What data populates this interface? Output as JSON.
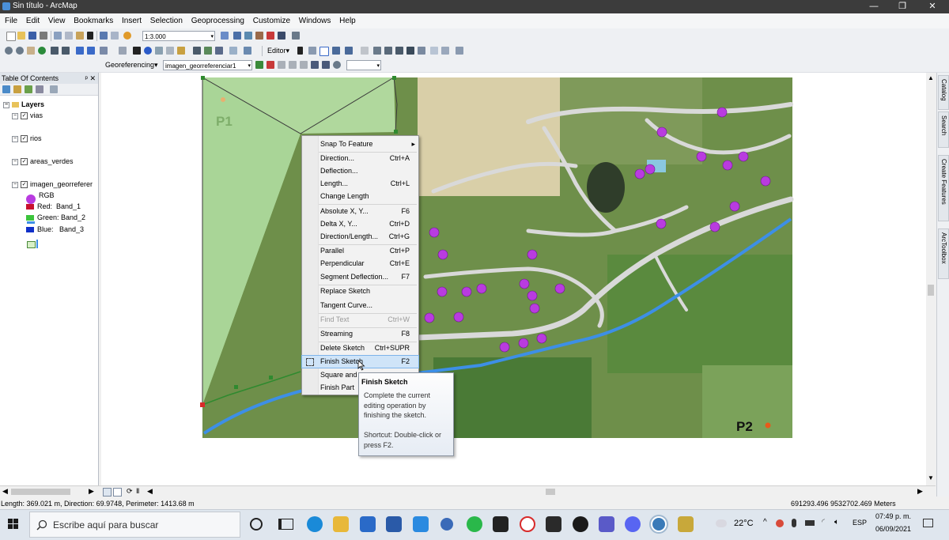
{
  "window": {
    "title": "Sin título - ArcMap",
    "minimize": "—",
    "maximize": "❐",
    "close": "✕"
  },
  "menu": [
    "File",
    "Edit",
    "View",
    "Bookmarks",
    "Insert",
    "Selection",
    "Geoprocessing",
    "Customize",
    "Windows",
    "Help"
  ],
  "toolbar": {
    "scale_value": "1:3.000",
    "editor_label": "Editor▾",
    "georef_label": "Georeferencing▾",
    "georef_layer": "imagen_georreferenciar1"
  },
  "toc": {
    "title": "Table Of Contents",
    "pin": "ᵖ ✕",
    "layers_label": "Layers",
    "layers": [
      {
        "name": "vias",
        "checked": true
      },
      {
        "name": "rios",
        "checked": true
      },
      {
        "name": "areas_verdes",
        "checked": true
      },
      {
        "name": "imagen_georreferer",
        "checked": true
      }
    ],
    "rgb_label": "RGB",
    "bands": [
      {
        "label": "Red:",
        "band": "Band_1",
        "color": "#c8102e"
      },
      {
        "label": "Green:",
        "band": "Band_2",
        "color": "#3cc43c"
      },
      {
        "label": "Blue:",
        "band": "Band_3",
        "color": "#1030c8"
      }
    ]
  },
  "map": {
    "label_p1": "P1",
    "label_p2": "P2",
    "road_color": "#d9d9d9",
    "river_color": "#3d8fe6",
    "point_color": "#b93be0",
    "green_area_color": "#b7e0a6"
  },
  "context_menu": {
    "items": [
      {
        "label": "Snap To Feature",
        "shortcut": "▸",
        "state": "normal"
      },
      {
        "label": "Direction...",
        "shortcut": "Ctrl+A",
        "state": "normal"
      },
      {
        "label": "Deflection...",
        "shortcut": "",
        "state": "normal"
      },
      {
        "label": "Length...",
        "shortcut": "Ctrl+L",
        "state": "normal"
      },
      {
        "label": "Change Length",
        "shortcut": "",
        "state": "normal"
      },
      {
        "label": "Absolute X, Y...",
        "shortcut": "F6",
        "state": "normal"
      },
      {
        "label": "Delta X, Y...",
        "shortcut": "Ctrl+D",
        "state": "normal"
      },
      {
        "label": "Direction/Length...",
        "shortcut": "Ctrl+G",
        "state": "normal"
      },
      {
        "label": "Parallel",
        "shortcut": "Ctrl+P",
        "state": "normal"
      },
      {
        "label": "Perpendicular",
        "shortcut": "Ctrl+E",
        "state": "normal"
      },
      {
        "label": "Segment Deflection...",
        "shortcut": "F7",
        "state": "normal"
      },
      {
        "label": "Replace Sketch",
        "shortcut": "",
        "state": "normal"
      },
      {
        "label": "Tangent Curve...",
        "shortcut": "",
        "state": "normal"
      },
      {
        "label": "Find Text",
        "shortcut": "Ctrl+W",
        "state": "disabled"
      },
      {
        "label": "Streaming",
        "shortcut": "F8",
        "state": "normal"
      },
      {
        "label": "Delete Sketch",
        "shortcut": "Ctrl+SUPR",
        "state": "normal"
      },
      {
        "label": "Finish Sketch",
        "shortcut": "F2",
        "state": "highlighted"
      },
      {
        "label": "Square and",
        "shortcut": "",
        "state": "normal"
      },
      {
        "label": "Finish Part",
        "shortcut": "",
        "state": "normal"
      }
    ]
  },
  "tooltip": {
    "title": "Finish Sketch",
    "body": "Complete the current editing operation by finishing the sketch.",
    "shortcut": "Shortcut: Double-click or press F2."
  },
  "dock_tabs": [
    "Catalog",
    "Search",
    "Create Features",
    "ArcToolbox"
  ],
  "status": {
    "left": "Length: 369.021 m, Direction: 69.9748, Perimeter: 1413.68 m",
    "coords": "691293.496  9532702.469 Meters"
  },
  "taskbar": {
    "search_placeholder": "Escribe aquí para buscar",
    "weather": "22°C",
    "lang": "ESP",
    "time": "07:49 p. m.",
    "date": "06/09/2021"
  }
}
